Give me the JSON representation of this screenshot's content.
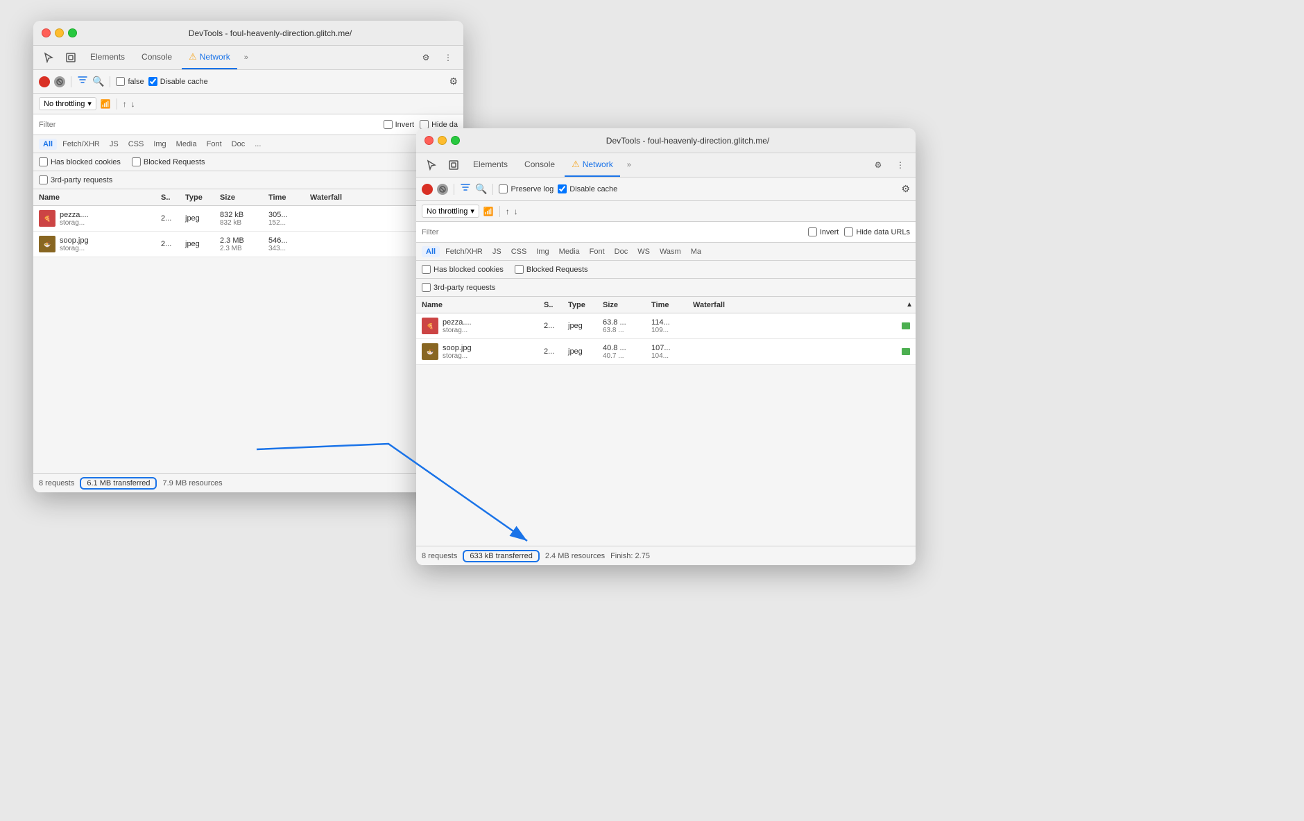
{
  "window1": {
    "title": "DevTools - foul-heavenly-direction.glitch.me/",
    "tabs": [
      "Elements",
      "Console",
      "Network"
    ],
    "activeTab": "Network",
    "toolbar": {
      "preserveLog": false,
      "disableCache": true
    },
    "throttling": "No throttling",
    "filterPlaceholder": "Filter",
    "typeFilters": [
      "All",
      "Fetch/XHR",
      "JS",
      "CSS",
      "Img",
      "Media",
      "Font",
      "Doc"
    ],
    "activeTypeFilter": "All",
    "checkboxes": {
      "hasBlockedCookies": "Has blocked cookies",
      "blockedRequests": "Blocked Requests",
      "thirdPartyRequests": "3rd-party requests"
    },
    "tableHeaders": {
      "name": "Name",
      "status": "S..",
      "type": "Type",
      "size": "Size",
      "time": "Time",
      "waterfall": "Waterfall"
    },
    "rows": [
      {
        "thumb": "pizza",
        "name": "pezza....",
        "subname": "storag...",
        "status": "2...",
        "type": "jpeg",
        "size": "832 kB",
        "sizeTransferred": "832 kB",
        "time": "305...",
        "timeSub": "152..."
      },
      {
        "thumb": "soop",
        "name": "soop.jpg",
        "subname": "storag...",
        "status": "2...",
        "type": "jpeg",
        "size": "2.3 MB",
        "sizeTransferred": "2.3 MB",
        "time": "546...",
        "timeSub": "343..."
      }
    ],
    "statusBar": {
      "requests": "8 requests",
      "transferred": "6.1 MB transferred",
      "resources": "7.9 MB resources"
    }
  },
  "window2": {
    "title": "DevTools - foul-heavenly-direction.glitch.me/",
    "tabs": [
      "Elements",
      "Console",
      "Network"
    ],
    "activeTab": "Network",
    "toolbar": {
      "preserveLog": false,
      "disableCache": true
    },
    "throttling": "No throttling",
    "filterPlaceholder": "Filter",
    "typeFilters": [
      "All",
      "Fetch/XHR",
      "JS",
      "CSS",
      "Img",
      "Media",
      "Font",
      "Doc",
      "WS",
      "Wasm",
      "Ma"
    ],
    "activeTypeFilter": "All",
    "checkboxes": {
      "hasBlockedCookies": "Has blocked cookies",
      "blockedRequests": "Blocked Requests",
      "thirdPartyRequests": "3rd-party requests"
    },
    "tableHeaders": {
      "name": "Name",
      "status": "S..",
      "type": "Type",
      "size": "Size",
      "time": "Time",
      "waterfall": "Waterfall"
    },
    "rows": [
      {
        "thumb": "pizza",
        "name": "pezza....",
        "subname": "storag...",
        "status": "2...",
        "type": "jpeg",
        "size": "63.8 ...",
        "sizeTransferred": "63.8 ...",
        "time": "114...",
        "timeSub": "109..."
      },
      {
        "thumb": "soop",
        "name": "soop.jpg",
        "subname": "storag...",
        "status": "2...",
        "type": "jpeg",
        "size": "40.8 ...",
        "sizeTransferred": "40.7 ...",
        "time": "107...",
        "timeSub": "104..."
      }
    ],
    "statusBar": {
      "requests": "8 requests",
      "transferred": "633 kB transferred",
      "resources": "2.4 MB resources",
      "finish": "Finish: 2.75"
    }
  },
  "icons": {
    "cursor": "⬚",
    "inspect": "⬚",
    "more": "≫",
    "settings": "⚙",
    "dots": "⋮",
    "filter": "⊿",
    "search": "🔍",
    "warning": "⚠",
    "upload": "↑",
    "download": "↓",
    "wifi": "📶",
    "checkbox_checked": "☑",
    "checkbox_unchecked": "☐",
    "sort_asc": "▲"
  }
}
